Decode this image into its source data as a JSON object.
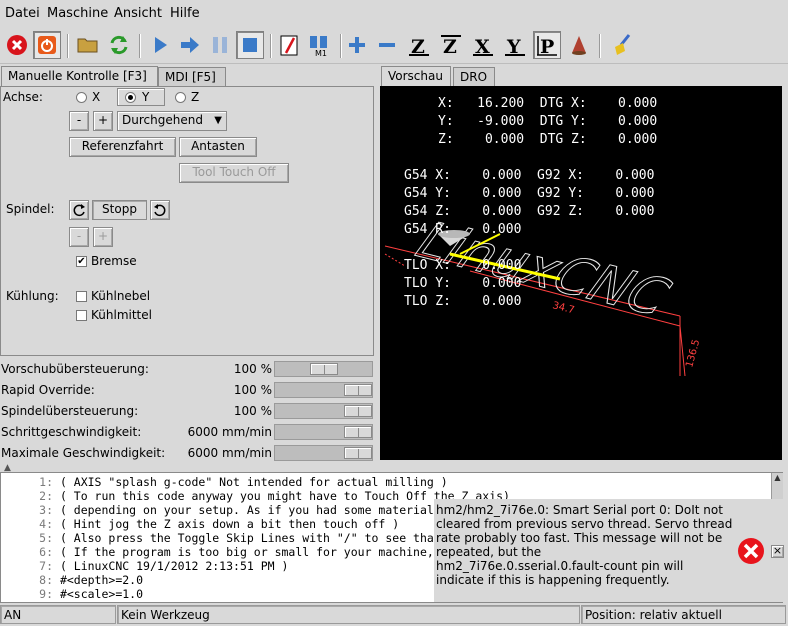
{
  "menu": [
    "Datei",
    "Maschine",
    "Ansicht",
    "Hilfe"
  ],
  "tabs_left": {
    "manual": "Manuelle Kontrolle [F3]",
    "mdi": "MDI [F5]"
  },
  "manual": {
    "axis_label": "Achse:",
    "axes": [
      "X",
      "Y",
      "Z"
    ],
    "selected_axis": "Y",
    "jog_minus": "-",
    "jog_plus": "+",
    "jog_mode": "Durchgehend",
    "home_button": "Referenzfahrt",
    "touch_button": "Antasten",
    "tool_touch_off": "Tool Touch Off",
    "spindle_label": "Spindel:",
    "spindle_stop": "Stopp",
    "spindle_minus": "-",
    "spindle_plus": "+",
    "brake": "Bremse",
    "brake_checked": true,
    "cooling_label": "Kühlung:",
    "mist": "Kühlnebel",
    "flood": "Kühlmittel"
  },
  "overrides": [
    {
      "label": "Vorschubübersteuerung:",
      "value": "100 %",
      "fraction": 0.5
    },
    {
      "label": "Rapid Override:",
      "value": "100 %",
      "fraction": 1.0
    },
    {
      "label": "Spindelübersteuerung:",
      "value": "100 %",
      "fraction": 1.0
    },
    {
      "label": "Schrittgeschwindigkeit:",
      "value": "6000 mm/min",
      "fraction": 1.0
    },
    {
      "label": "Maximale Geschwindigkeit:",
      "value": "6000 mm/min",
      "fraction": 1.0
    }
  ],
  "tabs_right": {
    "preview": "Vorschau",
    "dro": "DRO"
  },
  "dro": {
    "l1": "X:   16.200  DTG X:    0.000",
    "l2": "Y:   -9.000  DTG Y:    0.000",
    "l3": "Z:    0.000  DTG Z:    0.000",
    "l4": "G54 X:    0.000  G92 X:    0.000",
    "l5": "G54 Y:    0.000  G92 Y:    0.000",
    "l6": "G54 Z:    0.000  G92 Z:    0.000",
    "l7": "G54 R:    0.000",
    "l8": "TLO X:    0.000",
    "l9": "TLO Y:    0.000",
    "l10": "TLO Z:    0.000"
  },
  "preview": {
    "logo_text": "LinuxCNC",
    "dim1": "34.7",
    "dim2": "136.5"
  },
  "gcode": [
    {
      "n": "1:",
      "t": "( AXIS \"splash g-code\" Not intended for actual milling )"
    },
    {
      "n": "2:",
      "t": "( To run this code anyway you might have to Touch Off the Z axis)"
    },
    {
      "n": "3:",
      "t": "( depending on your setup. As if you had some material"
    },
    {
      "n": "4:",
      "t": "( Hint jog the Z axis down a bit then touch off )"
    },
    {
      "n": "5:",
      "t": "( Also press the Toggle Skip Lines with \"/\" to see tha"
    },
    {
      "n": "6:",
      "t": "( If the program is too big or small for your machine,"
    },
    {
      "n": "7:",
      "t": "( LinuxCNC 19/1/2012 2:13:51 PM )"
    },
    {
      "n": "8:",
      "t": "#<depth>=2.0"
    },
    {
      "n": "9:",
      "t": "#<scale>=1.0"
    }
  ],
  "message": {
    "l1": "hm2/hm2_7i76e.0: Smart Serial port 0: DoIt not",
    "l2": "cleared from previous servo thread. Servo thread",
    "l3": "rate probably too fast. This message will not be",
    "l4": "repeated, but the",
    "l5": "hm2_7i76e.0.sserial.0.fault-count pin will",
    "l6": "indicate if this is happening frequently.",
    "close": "×"
  },
  "status": {
    "mode": "AN",
    "tool": "Kein Werkzeug",
    "position": "Position: relativ aktuell"
  },
  "colors": {
    "preview_bg": "#000000",
    "path": "#ffff00",
    "dims": "#ff4040",
    "error": "#e8141c"
  }
}
